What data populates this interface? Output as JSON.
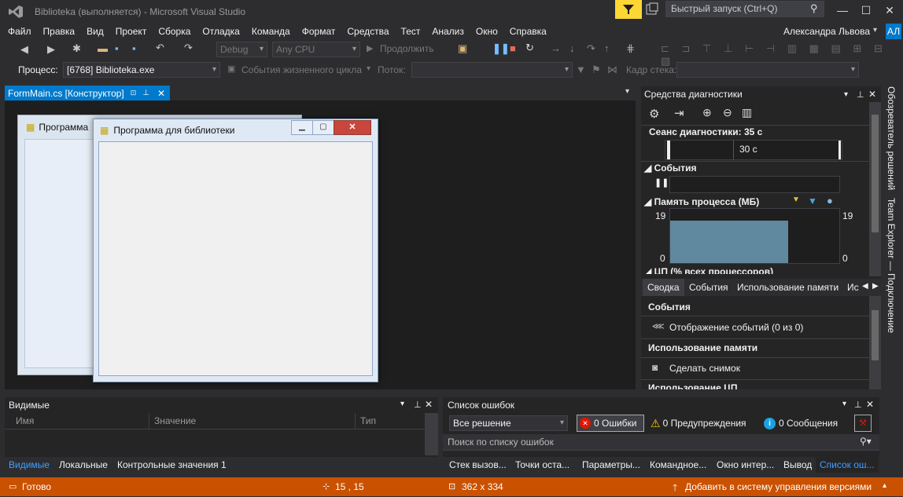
{
  "window": {
    "title": "Biblioteka (выполняется) - Microsoft Visual Studio",
    "quick_launch_placeholder": "Быстрый запуск (Ctrl+Q)",
    "user_name": "Александра Львова",
    "user_initials": "АЛ"
  },
  "menu": [
    "Файл",
    "Правка",
    "Вид",
    "Проект",
    "Сборка",
    "Отладка",
    "Команда",
    "Формат",
    "Средства",
    "Тест",
    "Анализ",
    "Окно",
    "Справка"
  ],
  "toolbar": {
    "config": "Debug",
    "platform": "Any CPU",
    "continue_label": "Продолжить",
    "process_label": "Процесс:",
    "process_value": "[6768] Biblioteka.exe",
    "lifecycle_label": "События жизненного цикла",
    "thread_label": "Поток:",
    "stack_frame_label": "Кадр стека:"
  },
  "document": {
    "tab_label": "FormMain.cs [Конструктор]",
    "bg_form_title": "Программа",
    "form_title": "Программа для библиотеки"
  },
  "diagnostics": {
    "title": "Средства диагностики",
    "session": "Сеанс диагностики: 35 с",
    "timeline_tick": "30 с",
    "events_section": "События",
    "memory_section": "Память процесса (МБ)",
    "memory_max": "19",
    "memory_min": "0",
    "memory_max_right": "19",
    "memory_min_right": "0",
    "cpu_section": "ЦП (% всех процессоров)",
    "tabs": [
      "Сводка",
      "События",
      "Использование памяти",
      "Ис"
    ],
    "summary": {
      "events_heading": "События",
      "events_row": "Отображение событий (0 из 0)",
      "memory_heading": "Использование памяти",
      "snapshot_row": "Сделать снимок",
      "cpu_heading": "Использование ЦП"
    },
    "memory_fraction": 0.78,
    "colors": {
      "memory_fill": "#60889e"
    }
  },
  "side_tabs": {
    "solution_explorer": "Обозреватель решений",
    "team_explorer": "Team Explorer — Подключение"
  },
  "watch": {
    "title": "Видимые",
    "columns": [
      "Имя",
      "Значение",
      "Тип"
    ],
    "tabs": [
      "Видимые",
      "Локальные",
      "Контрольные значения 1"
    ]
  },
  "errors": {
    "title": "Список ошибок",
    "scope": "Все решение",
    "errors_btn": "0 Ошибки",
    "warnings_btn": "0 Предупреждения",
    "messages_btn": "0 Сообщения",
    "search_placeholder": "Поиск по списку ошибок",
    "tabs": [
      "Стек вызов...",
      "Точки оста...",
      "Параметры...",
      "Командное...",
      "Окно интер...",
      "Вывод",
      "Список ош..."
    ]
  },
  "status": {
    "ready": "Готово",
    "position": "15 , 15",
    "size": "362 x 334",
    "source_control": "Добавить в систему управления версиями"
  },
  "colors": {
    "accent": "#007acc",
    "status_bar": "#ca5100"
  }
}
